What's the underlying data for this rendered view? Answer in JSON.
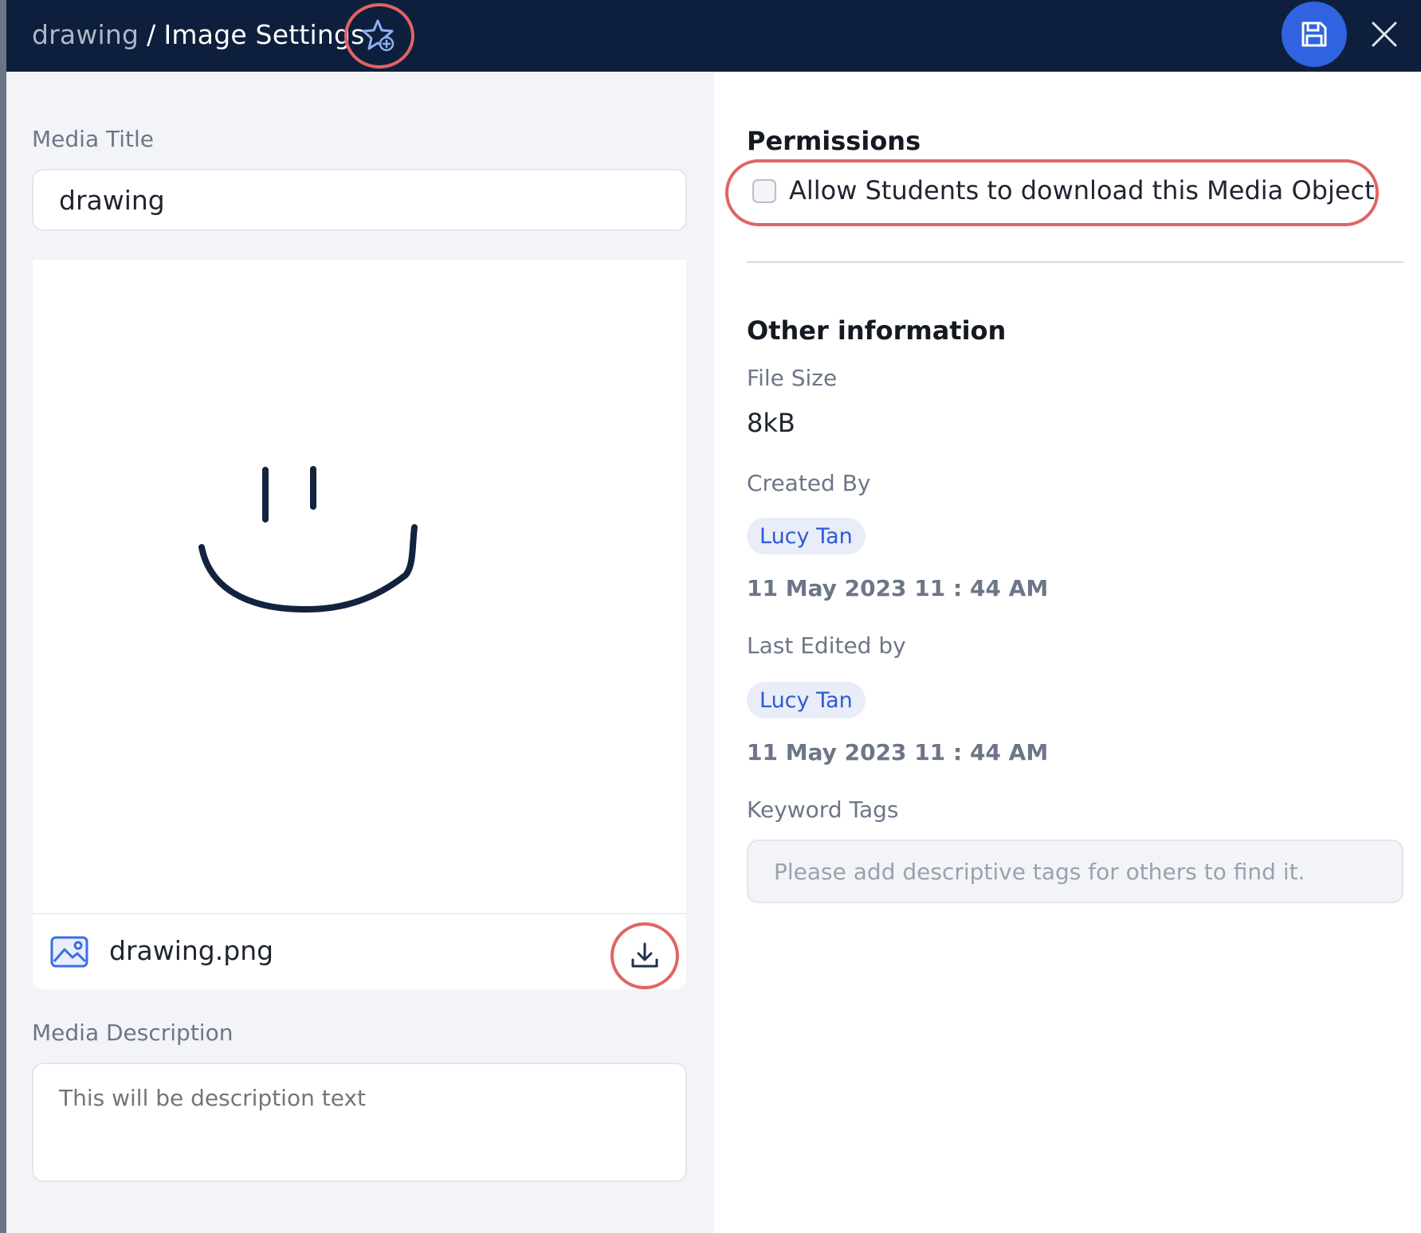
{
  "header": {
    "breadcrumb_parent": "drawing",
    "breadcrumb_separator": "/",
    "breadcrumb_current": "Image Settings",
    "favorite_icon": "star-plus-icon",
    "save_icon": "floppy-disk-icon",
    "close_icon": "close-icon"
  },
  "left": {
    "title_label": "Media Title",
    "title_value": "drawing",
    "file_name": "drawing.png",
    "file_icon": "image-file-icon",
    "download_icon": "download-icon",
    "description_label": "Media Description",
    "description_placeholder": "This will be description text"
  },
  "right": {
    "permissions_heading": "Permissions",
    "allow_download_label": "Allow Students to download this Media Object",
    "allow_download_checked": false,
    "other_info_heading": "Other information",
    "file_size_label": "File Size",
    "file_size_value": "8kB",
    "created_by_label": "Created By",
    "created_by_user": "Lucy Tan",
    "created_date": "11 May 2023 11 : 44 AM",
    "last_edited_label": "Last Edited by",
    "last_edited_user": "Lucy Tan",
    "last_edited_date": "11 May 2023 11 : 44 AM",
    "keyword_tags_label": "Keyword Tags",
    "keyword_tags_placeholder": "Please add descriptive tags for others to find it."
  },
  "colors": {
    "header_bg": "#0e1f3d",
    "accent_blue": "#2f63e0",
    "highlight_ring": "#e06464",
    "chip_text": "#2f5bd0"
  }
}
